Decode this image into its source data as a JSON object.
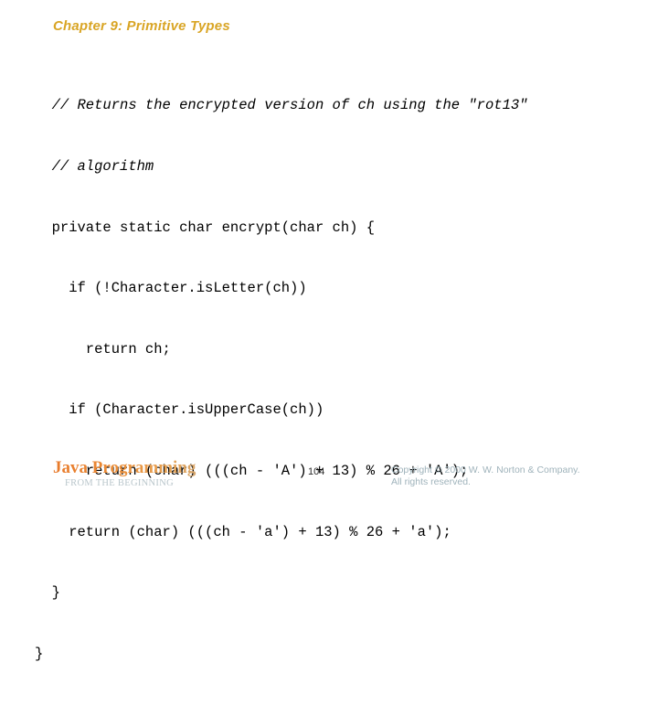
{
  "slide": {
    "title": "Chapter 9: Primitive Types",
    "background_color": "#ffffff",
    "title_color": "#d9a525"
  },
  "code": {
    "language": "java",
    "text_color": "#000000",
    "lines": [
      {
        "text": "  // Returns the encrypted version of ch using the \"rot13\"",
        "style": "comment"
      },
      {
        "text": "  // algorithm",
        "style": "comment"
      },
      {
        "text": "  private static char encrypt(char ch) {",
        "style": "code"
      },
      {
        "text": "    if (!Character.isLetter(ch))",
        "style": "code"
      },
      {
        "text": "      return ch;",
        "style": "code"
      },
      {
        "text": "    if (Character.isUpperCase(ch))",
        "style": "code"
      },
      {
        "text": "      return (char) (((ch - 'A') + 13) % 26 + 'A');",
        "style": "code"
      },
      {
        "text": "    return (char) (((ch - 'a') + 13) % 26 + 'a');",
        "style": "code"
      },
      {
        "text": "  }",
        "style": "code"
      },
      {
        "text": "}",
        "style": "code"
      }
    ]
  },
  "footer": {
    "brand_title": "Java Programming",
    "brand_subtitle": "FROM THE BEGINNING",
    "brand_title_color_start": "#e8792a",
    "brand_title_color_end": "#a9a79c",
    "brand_subtitle_color": "#b9c6cb",
    "page_number": "104",
    "copyright_line_1": "Copyright © 2000 W. W. Norton & Company.",
    "copyright_line_2": "All rights reserved.",
    "copyright_color": "#9fb3bb"
  }
}
